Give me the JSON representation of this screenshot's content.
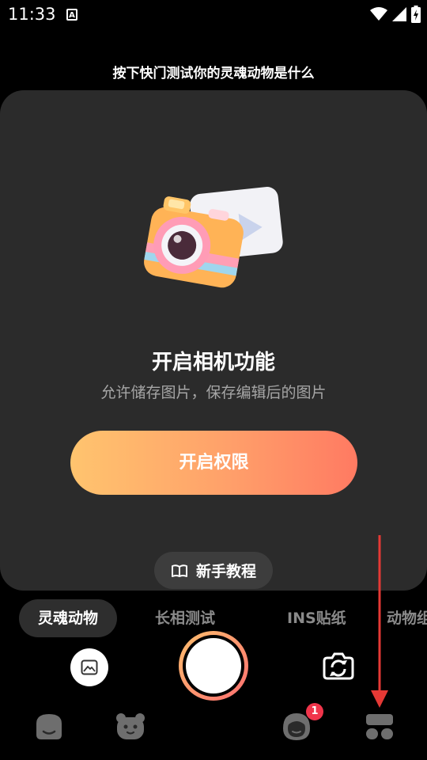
{
  "status_bar": {
    "time": "11:33",
    "notification_letter": "A"
  },
  "header": {
    "text": "按下快门测试你的灵魂动物是什么"
  },
  "permission_card": {
    "title": "开启相机功能",
    "subtitle": "允许储存图片，保存编辑后的图片",
    "button_label": "开启权限"
  },
  "tutorial": {
    "label": "新手教程"
  },
  "mode_tabs": [
    {
      "label": "灵魂动物",
      "active": true
    },
    {
      "label": "长相测试",
      "active": false
    },
    {
      "label": "INS贴纸",
      "active": false
    },
    {
      "label": "动物组",
      "active": false
    }
  ],
  "bottom_nav": {
    "badge_count": "1"
  },
  "colors": {
    "accent_start": "#ffc46e",
    "accent_end": "#ff7a62",
    "card_bg": "#2b2b2b",
    "badge": "#f0354b",
    "annotation_arrow": "#e53935"
  }
}
